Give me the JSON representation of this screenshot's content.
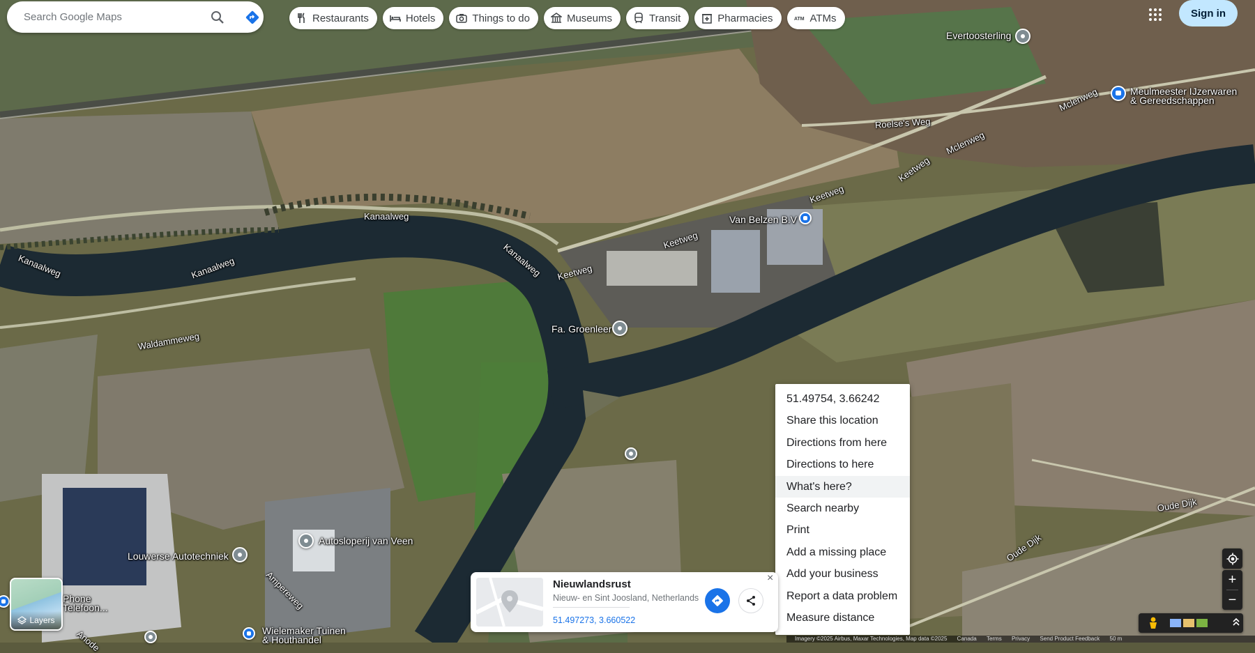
{
  "search": {
    "placeholder": "Search Google Maps",
    "search_icon": "search-icon",
    "directions_icon": "directions-icon"
  },
  "chips": [
    {
      "label": "Restaurants",
      "icon": "restaurant-icon"
    },
    {
      "label": "Hotels",
      "icon": "hotel-icon"
    },
    {
      "label": "Things to do",
      "icon": "camera-icon"
    },
    {
      "label": "Museums",
      "icon": "museum-icon"
    },
    {
      "label": "Transit",
      "icon": "transit-icon"
    },
    {
      "label": "Pharmacies",
      "icon": "pharmacy-icon"
    },
    {
      "label": "ATMs",
      "icon": "atm-icon"
    }
  ],
  "header": {
    "sign_in": "Sign in",
    "apps_icon": "apps-grid-icon"
  },
  "map_labels": {
    "evertoosterling": "Evertoosterling",
    "meulmeester": "Meulmeester IJzerwaren",
    "meulmeester2": "& Gereedschappen",
    "roelses_weg": "Roelse's Weg",
    "mclenweg1": "Mclenweg",
    "mclenweg2": "Mclenweg",
    "keetweg1": "Keetweg",
    "keetweg2": "Keetweg",
    "keetweg3": "Keetweg",
    "keetweg4": "Keetweg",
    "van_belzen": "Van Belzen B.V",
    "kanaalweg1": "Kanaalweg",
    "kanaalweg2": "Kanaalweg",
    "kanaalweg3": "Kanaalweg",
    "kanaalweg4": "Kanaalweg",
    "waldammeweg": "Waldammeweg",
    "groenleer": "Fa. Groenleer",
    "oude_dijk1": "Oude Dijk",
    "oude_dijk2": "Oude Dijk",
    "louwerse": "Louwerse Autotechniek",
    "autosloperij": "Autosloperij van Veen",
    "amperweg": "Ampereweg",
    "wielemaker": "Wielemaker Tuinen",
    "houthandel": "& Houthandel",
    "phone": "Phone",
    "telefoon": "Telefoon...",
    "anode": "Anode"
  },
  "context_menu": {
    "items": [
      "51.49754, 3.66242",
      "Share this location",
      "Directions from here",
      "Directions to here",
      "What's here?",
      "Search nearby",
      "Print",
      "Add a missing place",
      "Add your business",
      "Report a data problem",
      "Measure distance"
    ],
    "highlighted_index": 4
  },
  "place_card": {
    "title": "Nieuwlandsrust",
    "subtitle": "Nieuw- en Sint Joosland, Netherlands",
    "coords": "51.497273, 3.660522",
    "close": "×"
  },
  "layers": {
    "label": "Layers"
  },
  "controls": {
    "zoom_in": "+",
    "zoom_out": "−"
  },
  "footer": {
    "imagery": "Imagery ©2025 Airbus, Maxar Technologies, Map data ©2025",
    "country": "Canada",
    "terms": "Terms",
    "privacy": "Privacy",
    "feedback": "Send Product Feedback",
    "scale": "50 m"
  },
  "colors": {
    "accent": "#1a73e8",
    "sign_in_bg": "#c2e7ff",
    "water": "#1c2a33"
  }
}
